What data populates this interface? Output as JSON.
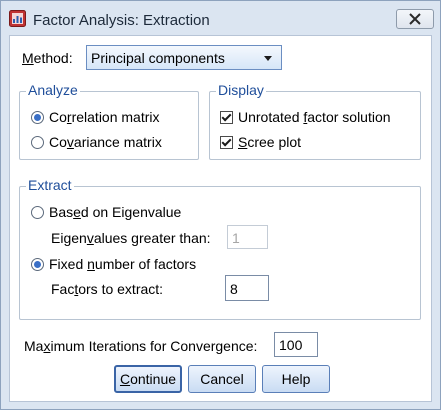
{
  "window": {
    "title": "Factor Analysis: Extraction",
    "icons": {
      "app": "spss-dialog-icon",
      "close": "close-icon"
    }
  },
  "method": {
    "label_pre": "",
    "label_hotkey": "M",
    "label_post": "ethod:",
    "selected": "Principal components"
  },
  "analyze": {
    "legend": "Analyze",
    "options": [
      {
        "pre": "Co",
        "hotkey": "r",
        "post": "relation matrix",
        "selected": true
      },
      {
        "pre": "Co",
        "hotkey": "v",
        "post": "ariance matrix",
        "selected": false
      }
    ]
  },
  "display": {
    "legend": "Display",
    "options": [
      {
        "pre": "Unrotated ",
        "hotkey": "f",
        "post": "actor solution",
        "checked": true
      },
      {
        "pre": "",
        "hotkey": "S",
        "post": "cree plot",
        "checked": true
      }
    ]
  },
  "extract": {
    "legend": "Extract",
    "eigen": {
      "pre": "Bas",
      "hotkey": "e",
      "post": "d on Eigenvalue",
      "selected": false
    },
    "eigen_threshold": {
      "pre": "Eigen",
      "hotkey": "v",
      "post": "alues greater than:",
      "value": "1"
    },
    "fixed": {
      "pre": "Fixed ",
      "hotkey": "n",
      "post": "umber of factors",
      "selected": true
    },
    "factors": {
      "pre": "Fac",
      "hotkey": "t",
      "post": "ors to extract:",
      "value": "8"
    }
  },
  "iterations": {
    "pre": "Ma",
    "hotkey": "x",
    "post": "imum Iterations for Convergence:",
    "value": "100"
  },
  "buttons": {
    "continue": {
      "pre": "",
      "hotkey": "C",
      "post": "ontinue"
    },
    "cancel": {
      "label": "Cancel"
    },
    "help": {
      "label": "Help"
    }
  }
}
